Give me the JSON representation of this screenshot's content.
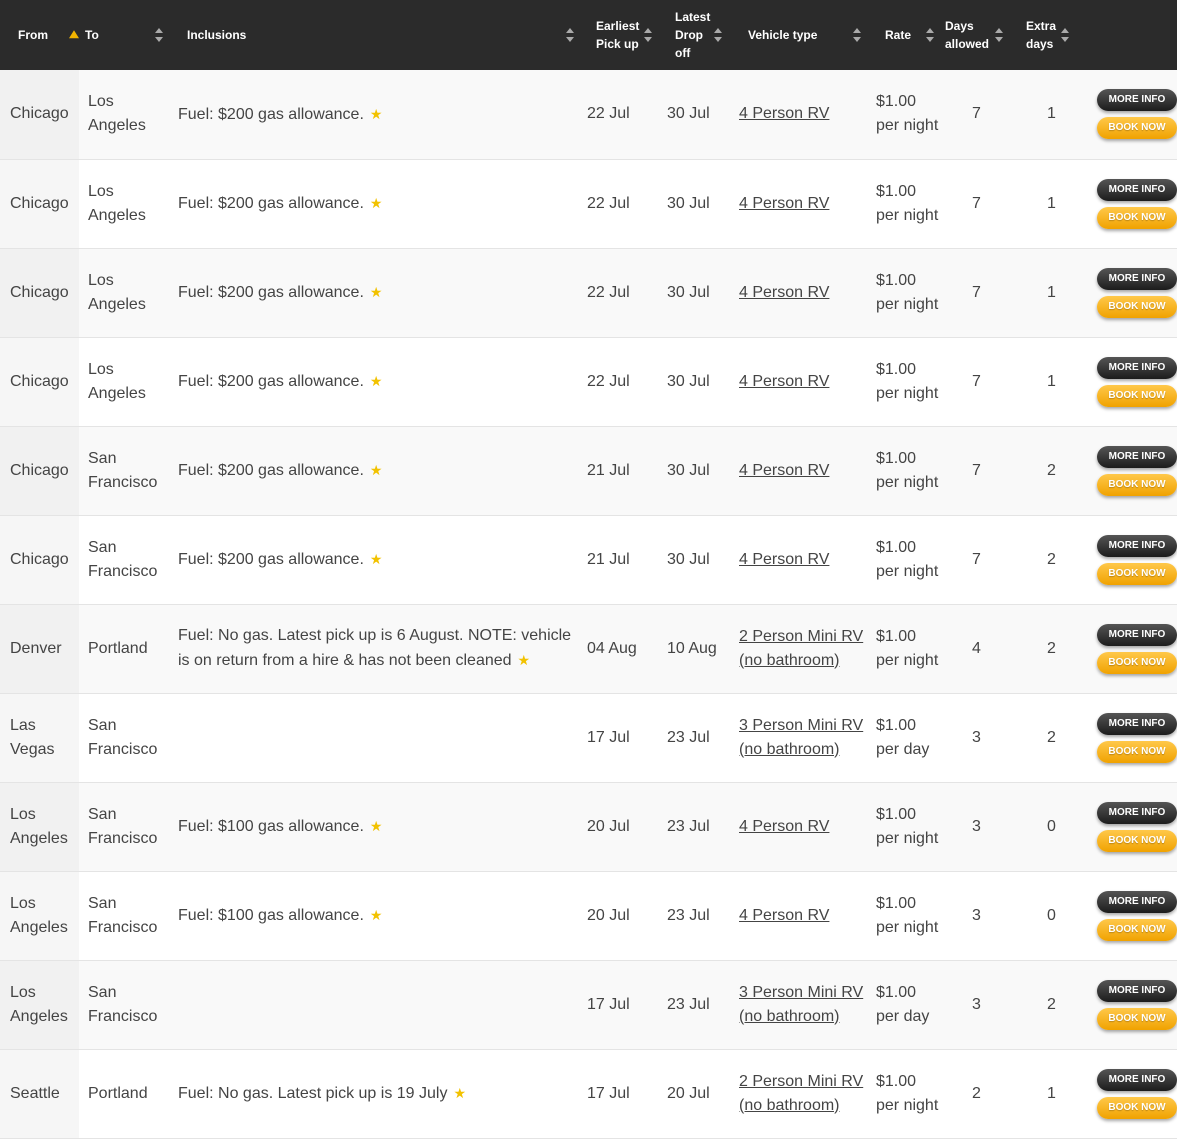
{
  "colors": {
    "header_bg": "#2b2b2b",
    "accent": "#f2b400",
    "text": "#444444"
  },
  "headers": {
    "from": "From",
    "to": "To",
    "inclusions": "Inclusions",
    "earliest": "Earliest Pick up",
    "latest": "Latest Drop off",
    "vehicle": "Vehicle type",
    "rate": "Rate",
    "days": "Days allowed",
    "extra": "Extra days"
  },
  "buttons": {
    "more_info": "MORE INFO",
    "book_now": "BOOK NOW"
  },
  "star_glyph": "★",
  "rows": [
    {
      "from": "Chicago",
      "to": "Los Angeles",
      "inclusions": "Fuel: $200 gas allowance.",
      "star": true,
      "pickup": "22 Jul",
      "dropoff": "30 Jul",
      "vehicle": "4 Person RV",
      "rate": "$1.00 per night",
      "days": "7",
      "extra": "1"
    },
    {
      "from": "Chicago",
      "to": "Los Angeles",
      "inclusions": "Fuel: $200 gas allowance.",
      "star": true,
      "pickup": "22 Jul",
      "dropoff": "30 Jul",
      "vehicle": "4 Person RV",
      "rate": "$1.00 per night",
      "days": "7",
      "extra": "1"
    },
    {
      "from": "Chicago",
      "to": "Los Angeles",
      "inclusions": "Fuel: $200 gas allowance.",
      "star": true,
      "pickup": "22 Jul",
      "dropoff": "30 Jul",
      "vehicle": "4 Person RV",
      "rate": "$1.00 per night",
      "days": "7",
      "extra": "1"
    },
    {
      "from": "Chicago",
      "to": "Los Angeles",
      "inclusions": "Fuel: $200 gas allowance.",
      "star": true,
      "pickup": "22 Jul",
      "dropoff": "30 Jul",
      "vehicle": "4 Person RV",
      "rate": "$1.00 per night",
      "days": "7",
      "extra": "1"
    },
    {
      "from": "Chicago",
      "to": "San Francisco",
      "inclusions": "Fuel: $200 gas allowance.",
      "star": true,
      "pickup": "21 Jul",
      "dropoff": "30 Jul",
      "vehicle": "4 Person RV",
      "rate": "$1.00 per night",
      "days": "7",
      "extra": "2"
    },
    {
      "from": "Chicago",
      "to": "San Francisco",
      "inclusions": "Fuel: $200 gas allowance.",
      "star": true,
      "pickup": "21 Jul",
      "dropoff": "30 Jul",
      "vehicle": "4 Person RV",
      "rate": "$1.00 per night",
      "days": "7",
      "extra": "2"
    },
    {
      "from": "Denver",
      "to": "Portland",
      "inclusions": "Fuel: No gas. Latest pick up is 6 August. NOTE: vehicle is on return from a hire & has not been cleaned",
      "star": true,
      "pickup": "04 Aug",
      "dropoff": "10 Aug",
      "vehicle": "2 Person Mini RV (no bathroom)",
      "rate": "$1.00 per night",
      "days": "4",
      "extra": "2"
    },
    {
      "from": "Las Vegas",
      "to": "San Francisco",
      "inclusions": "",
      "star": false,
      "pickup": "17 Jul",
      "dropoff": "23 Jul",
      "vehicle": "3 Person Mini RV (no bathroom)",
      "rate": "$1.00 per day",
      "days": "3",
      "extra": "2"
    },
    {
      "from": "Los Angeles",
      "to": "San Francisco",
      "inclusions": "Fuel: $100 gas allowance.",
      "star": true,
      "pickup": "20 Jul",
      "dropoff": "23 Jul",
      "vehicle": "4 Person RV",
      "rate": "$1.00 per night",
      "days": "3",
      "extra": "0"
    },
    {
      "from": "Los Angeles",
      "to": "San Francisco",
      "inclusions": "Fuel: $100 gas allowance.",
      "star": true,
      "pickup": "20 Jul",
      "dropoff": "23 Jul",
      "vehicle": "4 Person RV",
      "rate": "$1.00 per night",
      "days": "3",
      "extra": "0"
    },
    {
      "from": "Los Angeles",
      "to": "San Francisco",
      "inclusions": "",
      "star": false,
      "pickup": "17 Jul",
      "dropoff": "23 Jul",
      "vehicle": "3 Person Mini RV (no bathroom)",
      "rate": "$1.00 per day",
      "days": "3",
      "extra": "2"
    },
    {
      "from": "Seattle",
      "to": "Portland",
      "inclusions": "Fuel: No gas. Latest pick up is 19 July",
      "star": true,
      "pickup": "17 Jul",
      "dropoff": "20 Jul",
      "vehicle": "2 Person Mini RV (no bathroom)",
      "rate": "$1.00 per night",
      "days": "2",
      "extra": "1"
    }
  ]
}
